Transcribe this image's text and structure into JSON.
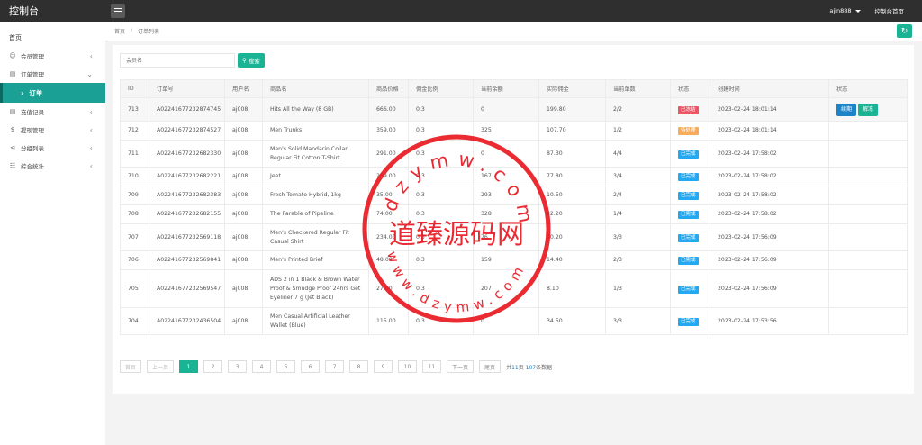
{
  "header": {
    "brand": "控制台",
    "user": "ajin888",
    "home_link": "控制台首页"
  },
  "sidebar": {
    "home": "首页",
    "items": [
      {
        "label": "会员管理",
        "icon": "user-icon"
      },
      {
        "label": "订单管理",
        "icon": "order-icon",
        "expanded": true
      },
      {
        "label": "充值记录",
        "icon": "recharge-icon"
      },
      {
        "label": "提现管理",
        "icon": "withdraw-icon"
      },
      {
        "label": "分组列表",
        "icon": "group-icon"
      },
      {
        "label": "综合统计",
        "icon": "stats-icon"
      }
    ],
    "active_sub": "订单"
  },
  "breadcrumb": {
    "home": "首页",
    "current": "订单列表"
  },
  "search": {
    "placeholder": "会员名",
    "button": "搜索"
  },
  "table": {
    "headers": [
      "ID",
      "订单号",
      "用户名",
      "商品名",
      "商品价格",
      "佣金比例",
      "当前余额",
      "实际佣金",
      "当前单数",
      "状态",
      "创建时间",
      "状态"
    ],
    "rows": [
      {
        "id": "713",
        "order": "A02241677232874745",
        "user": "aj008",
        "product": "Hits All the Way (8 GB)",
        "price": "666.00",
        "rate": "0.3",
        "balance": "0",
        "commission": "199.80",
        "count": "2/2",
        "status": "已冻结",
        "status_color": "#ed5565",
        "time": "2023-02-24 18:01:14",
        "ops": [
          "续期",
          "解冻"
        ]
      },
      {
        "id": "712",
        "order": "A02241677232874527",
        "user": "aj008",
        "product": "Men Trunks",
        "price": "359.00",
        "rate": "0.3",
        "balance": "325",
        "commission": "107.70",
        "count": "1/2",
        "status": "待处理",
        "status_color": "#f8ac59",
        "time": "2023-02-24 18:01:14",
        "ops": []
      },
      {
        "id": "711",
        "order": "A02241677232682330",
        "user": "aj008",
        "product": "Men's Solid Mandarin Collar Regular Fit Cotton T-Shirt",
        "price": "291.00",
        "rate": "0.3",
        "balance": "0",
        "commission": "87.30",
        "count": "4/4",
        "status": "已完成",
        "status_color": "#23a9f2",
        "time": "2023-02-24 17:58:02",
        "ops": []
      },
      {
        "id": "710",
        "order": "A02241677232682221",
        "user": "aj008",
        "product": "Jeet",
        "price": "259.00",
        "rate": "0.3",
        "balance": "167",
        "commission": "77.80",
        "count": "3/4",
        "status": "已完成",
        "status_color": "#23a9f2",
        "time": "2023-02-24 17:58:02",
        "ops": []
      },
      {
        "id": "709",
        "order": "A02241677232682383",
        "user": "aj008",
        "product": "Fresh Tomato Hybrid, 1kg",
        "price": "35.00",
        "rate": "0.3",
        "balance": "293",
        "commission": "10.50",
        "count": "2/4",
        "status": "已完成",
        "status_color": "#23a9f2",
        "time": "2023-02-24 17:58:02",
        "ops": []
      },
      {
        "id": "708",
        "order": "A02241677232682155",
        "user": "aj008",
        "product": "The Parable of Pipeline",
        "price": "74.00",
        "rate": "0.3",
        "balance": "328",
        "commission": "22.20",
        "count": "1/4",
        "status": "已完成",
        "status_color": "#23a9f2",
        "time": "2023-02-24 17:58:02",
        "ops": []
      },
      {
        "id": "707",
        "order": "A02241677232569118",
        "user": "aj008",
        "product": "Men's Checkered Regular Fit Casual Shirt",
        "price": "234.00",
        "rate": "0.3",
        "balance": "76",
        "commission": "70.20",
        "count": "3/3",
        "status": "已完成",
        "status_color": "#23a9f2",
        "time": "2023-02-24 17:56:09",
        "ops": []
      },
      {
        "id": "706",
        "order": "A02241677232569841",
        "user": "aj008",
        "product": "Men's Printed Brief",
        "price": "48.00",
        "rate": "0.3",
        "balance": "159",
        "commission": "14.40",
        "count": "2/3",
        "status": "已完成",
        "status_color": "#23a9f2",
        "time": "2023-02-24 17:56:09",
        "ops": []
      },
      {
        "id": "705",
        "order": "A02241677232569547",
        "user": "aj008",
        "product": "ADS 2 in 1 Black & Brown Water Proof & Smudge Proof 24hrs Get Eyeliner 7 g (Jet Black)",
        "price": "27.00",
        "rate": "0.3",
        "balance": "207",
        "commission": "8.10",
        "count": "1/3",
        "status": "已完成",
        "status_color": "#23a9f2",
        "time": "2023-02-24 17:56:09",
        "ops": []
      },
      {
        "id": "704",
        "order": "A02241677232436504",
        "user": "aj008",
        "product": "Men Casual Artificial Leather Wallet (Blue)",
        "price": "115.00",
        "rate": "0.3",
        "balance": "0",
        "commission": "34.50",
        "count": "3/3",
        "status": "已完成",
        "status_color": "#23a9f2",
        "time": "2023-02-24 17:53:56",
        "ops": []
      }
    ]
  },
  "pagination": {
    "first": "首页",
    "prev": "上一页",
    "next": "下一页",
    "last": "尾页",
    "pages": [
      "1",
      "2",
      "3",
      "4",
      "5",
      "6",
      "7",
      "8",
      "9",
      "10",
      "11"
    ],
    "active": "1",
    "info_prefix": "共",
    "info_pages": "11",
    "info_mid": "页",
    "info_total": "107",
    "info_suffix": "条数据"
  },
  "watermark": {
    "top_text": "dzymw.com",
    "center_text": "道臻源码网",
    "bottom_text": "www.dzymw.com",
    "color": "#e8141c"
  }
}
